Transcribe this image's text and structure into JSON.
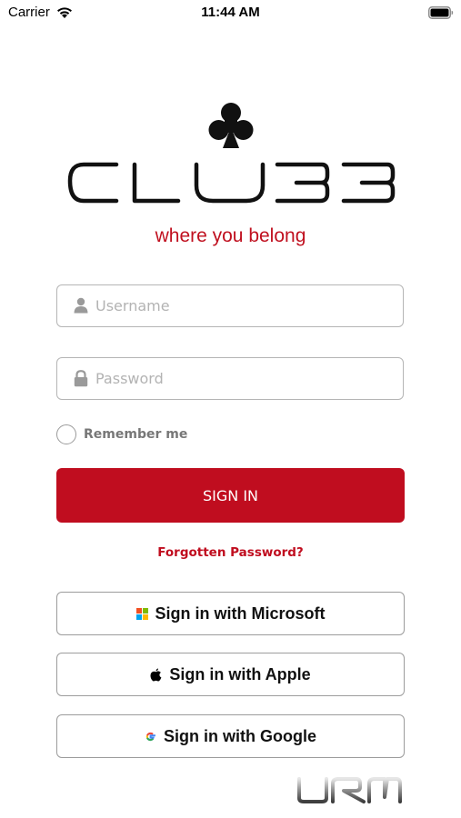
{
  "status_bar": {
    "carrier": "Carrier",
    "time": "11:44 AM"
  },
  "brand": {
    "logo_text": "CLUBB",
    "tagline": "where you belong",
    "accent_color": "#c00d1f"
  },
  "form": {
    "username_placeholder": "Username",
    "password_placeholder": "Password",
    "remember_label": "Remember me",
    "sign_in_label": "SIGN IN",
    "forgot_label": "Forgotten Password?"
  },
  "sso": {
    "microsoft_label": "Sign in with Microsoft",
    "apple_label": "Sign in with Apple",
    "google_label": "Sign in with Google"
  },
  "vendor_logo_text": "URM"
}
